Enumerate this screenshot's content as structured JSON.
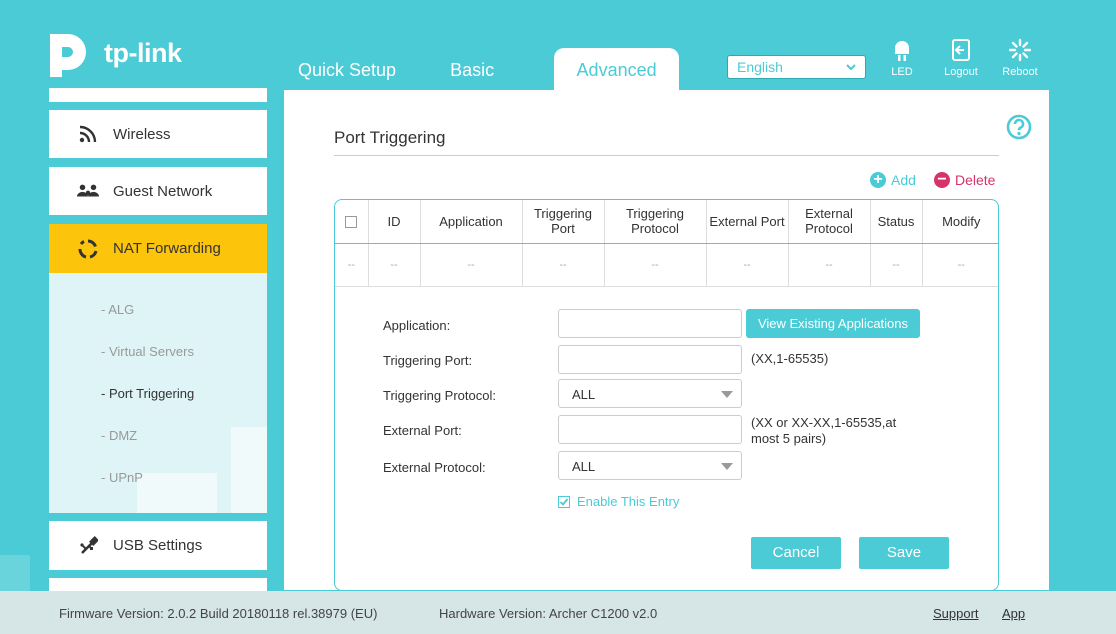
{
  "header": {
    "brand": "tp-link",
    "tabs": [
      {
        "label": "Quick Setup"
      },
      {
        "label": "Basic"
      },
      {
        "label": "Advanced"
      }
    ],
    "language": "English",
    "icons": [
      {
        "label": "LED",
        "icon": "led-icon"
      },
      {
        "label": "Logout",
        "icon": "logout-icon"
      },
      {
        "label": "Reboot",
        "icon": "reboot-icon"
      }
    ]
  },
  "sidebar": {
    "items": [
      {
        "label": "Wireless",
        "icon": "wifi-icon"
      },
      {
        "label": "Guest Network",
        "icon": "guest-network-icon"
      },
      {
        "label": "NAT Forwarding",
        "icon": "nat-forwarding-icon"
      },
      {
        "label": "USB Settings",
        "icon": "usb-icon"
      }
    ],
    "subitems": [
      {
        "label": "- ALG"
      },
      {
        "label": "- Virtual Servers"
      },
      {
        "label": "- Port Triggering"
      },
      {
        "label": "- DMZ"
      },
      {
        "label": "- UPnP"
      }
    ]
  },
  "main": {
    "title": "Port Triggering",
    "add_label": "Add",
    "delete_label": "Delete",
    "table": {
      "columns": [
        "ID",
        "Application",
        "Triggering Port",
        "Triggering Protocol",
        "External Port",
        "External Protocol",
        "Status",
        "Modify"
      ],
      "empty_row": [
        "--",
        "--",
        "--",
        "--",
        "--",
        "--",
        "--",
        "--",
        "--"
      ]
    },
    "form": {
      "application_label": "Application:",
      "view_apps_button": "View Existing Applications",
      "triggering_port_label": "Triggering Port:",
      "triggering_port_hint": "(XX,1-65535)",
      "triggering_protocol_label": "Triggering Protocol:",
      "triggering_protocol_value": "ALL",
      "external_port_label": "External Port:",
      "external_port_hint": "(XX or XX-XX,1-65535,at most 5 pairs)",
      "external_protocol_label": "External Protocol:",
      "external_protocol_value": "ALL",
      "enable_label": "Enable This Entry",
      "enable_checked": true,
      "cancel_button": "Cancel",
      "save_button": "Save"
    }
  },
  "footer": {
    "firmware": "Firmware Version: 2.0.2 Build 20180118 rel.38979 (EU)",
    "hardware": "Hardware Version: Archer C1200 v2.0",
    "support": "Support",
    "app": "App"
  },
  "colors": {
    "accent": "#4acbd6",
    "active_nav": "#fcc40a",
    "delete": "#d6336c"
  }
}
